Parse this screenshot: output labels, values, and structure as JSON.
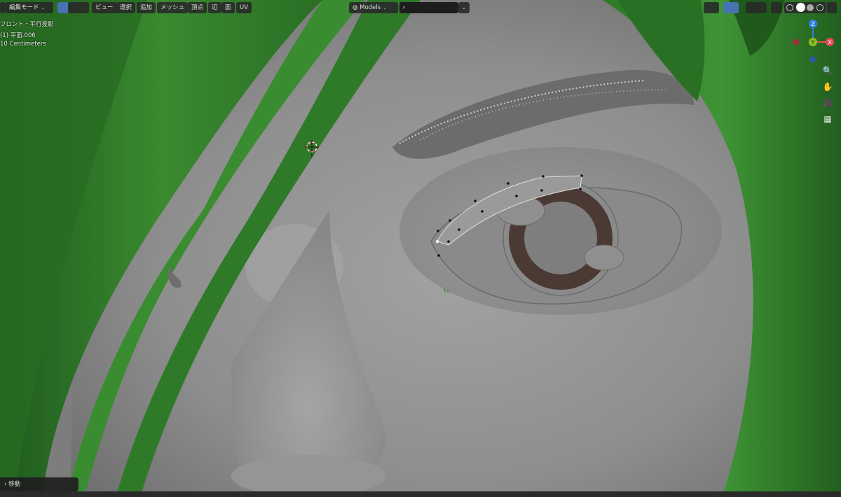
{
  "header": {
    "mode_label": "編集モード",
    "menus": [
      "ビュー",
      "選択",
      "追加",
      "メッシュ",
      "頂点",
      "辺",
      "面",
      "UV"
    ],
    "collection_label": "Models",
    "search_placeholder": "",
    "search_dropdown": "⌄"
  },
  "overlay": {
    "view_name": "フロント・平行投影",
    "object_name": "(1) 平面.006",
    "units": "10 Centimeters"
  },
  "gizmo": {
    "z_label": "Z",
    "y_label": "Y",
    "x_label": "X"
  },
  "status": {
    "last_operator": "移動"
  },
  "colors": {
    "active_blue": "#4772b3",
    "axis_x": "#e24a57",
    "axis_y": "#8bc21e",
    "axis_z": "#2f80e2",
    "hair_green": "#2f7a28",
    "skin_gray": "#8f8f8f"
  }
}
